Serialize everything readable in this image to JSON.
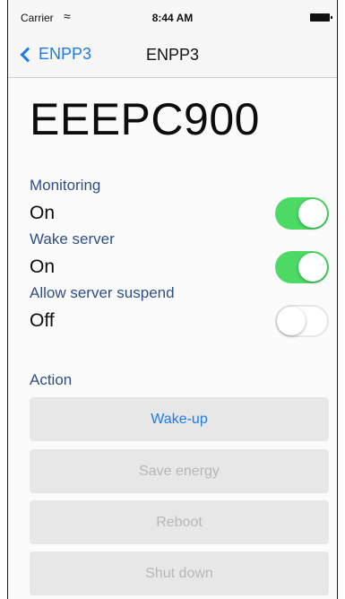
{
  "status_bar": {
    "carrier": "Carrier",
    "time": "8:44 AM"
  },
  "nav": {
    "back_label": "ENPP3",
    "title": "ENPP3"
  },
  "host_name": "EEEPC900",
  "settings": [
    {
      "label": "Monitoring",
      "value": "On",
      "toggle": true
    },
    {
      "label": "Wake server",
      "value": "On",
      "toggle": true
    },
    {
      "label": "Allow server suspend",
      "value": "Off",
      "toggle": false
    }
  ],
  "action": {
    "label": "Action",
    "buttons": [
      {
        "label": "Wake-up",
        "enabled": true
      },
      {
        "label": "Save energy",
        "enabled": false
      },
      {
        "label": "Reboot",
        "enabled": false
      },
      {
        "label": "Shut down",
        "enabled": false
      }
    ]
  },
  "colors": {
    "accent": "#1b7cf0",
    "toggle_on": "#4cd964",
    "section_label": "#2f4f86",
    "disabled_text": "#b7b7b7"
  },
  "icons": {
    "wifi": "wifi-icon",
    "battery": "battery-icon",
    "back": "chevron-left-icon"
  }
}
